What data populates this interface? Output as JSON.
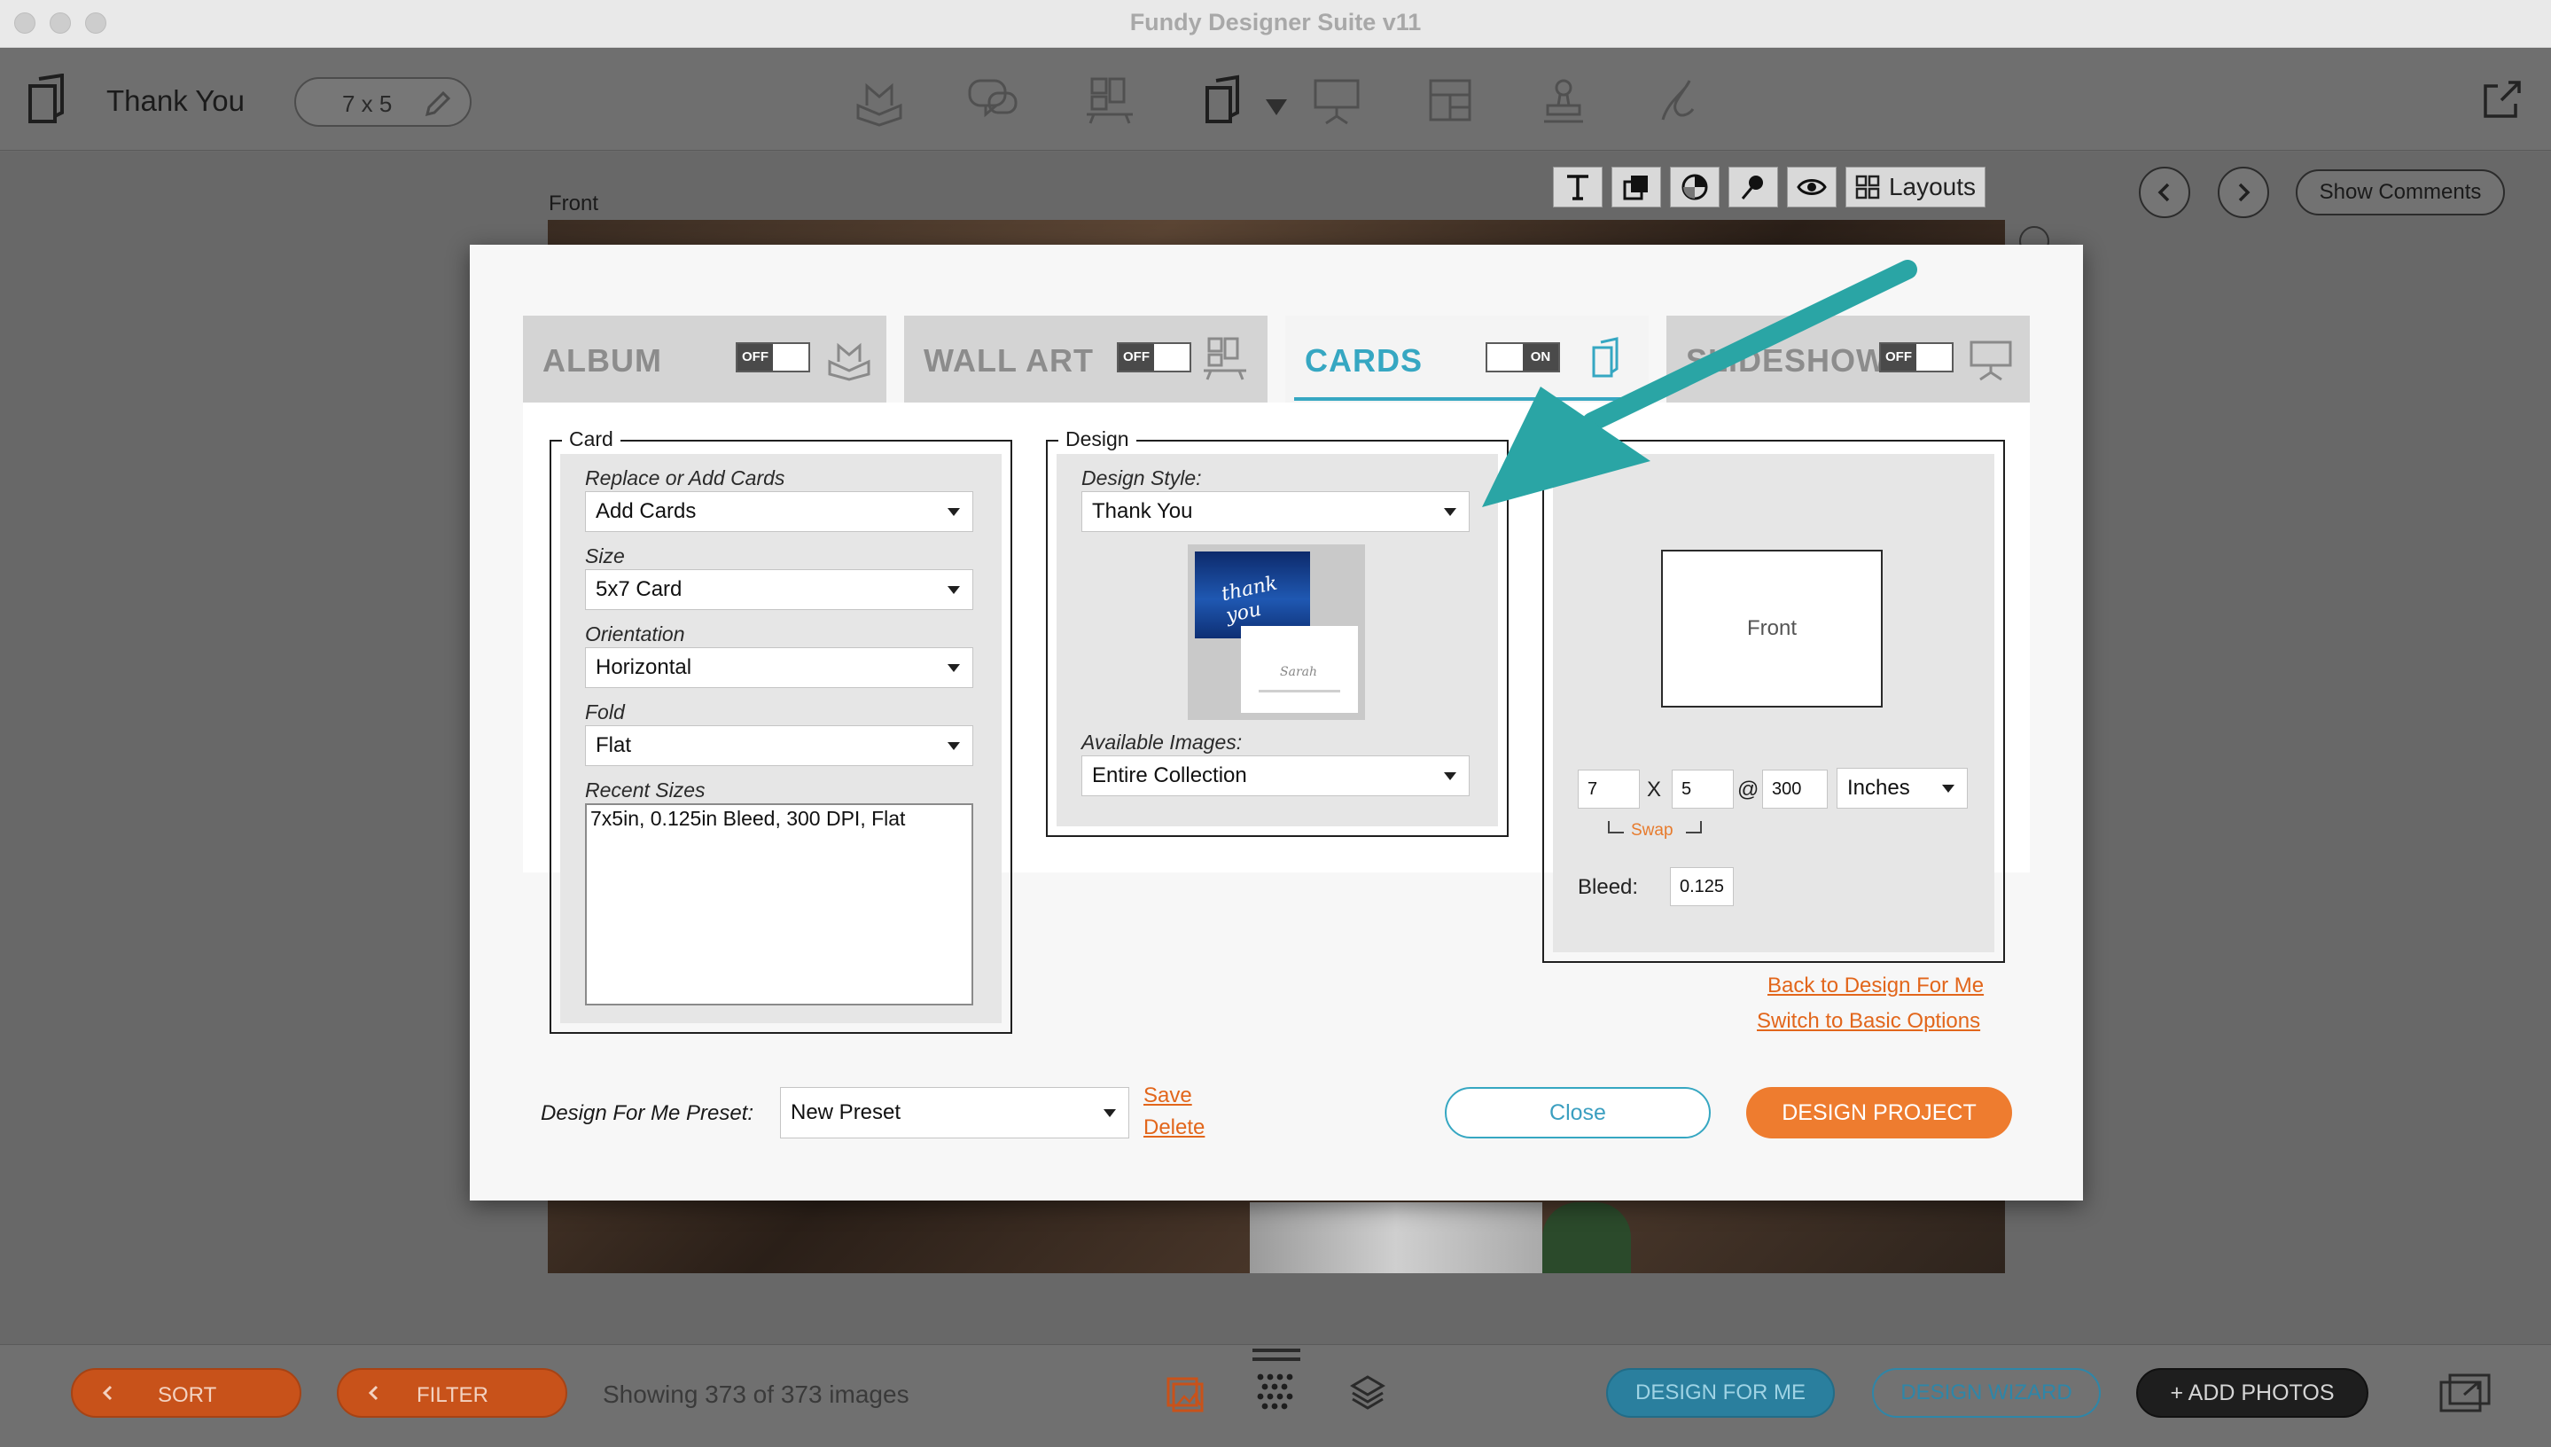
{
  "window": {
    "title": "Fundy Designer Suite v11"
  },
  "toolbar": {
    "doc_title": "Thank You",
    "size_pill": "7 x 5",
    "mode_icons": [
      "album-icon",
      "chat-icon",
      "wall-art-icon",
      "cards-icon",
      "slideshow-icon",
      "layout-icon",
      "stamp-icon",
      "signature-icon"
    ]
  },
  "workspace": {
    "front_label": "Front",
    "layouts_label": "Layouts",
    "show_comments_label": "Show Comments"
  },
  "modal": {
    "tabs": [
      {
        "label": "ALBUM",
        "toggle": "OFF",
        "active": false
      },
      {
        "label": "WALL ART",
        "toggle": "OFF",
        "active": false
      },
      {
        "label": "CARDS",
        "toggle": "ON",
        "active": true
      },
      {
        "label": "SLIDESHOW",
        "toggle": "OFF",
        "active": false
      }
    ],
    "card_group": {
      "legend": "Card",
      "replace_label": "Replace or Add Cards",
      "replace_value": "Add Cards",
      "size_label": "Size",
      "size_value": "5x7 Card",
      "orientation_label": "Orientation",
      "orientation_value": "Horizontal",
      "fold_label": "Fold",
      "fold_value": "Flat",
      "recent_label": "Recent Sizes",
      "recent_items": [
        "7x5in, 0.125in Bleed, 300 DPI, Flat"
      ]
    },
    "design_group": {
      "legend": "Design",
      "style_label": "Design Style:",
      "style_value": "Thank You",
      "thumb_script": "thank you",
      "thumb_signature": "Sarah",
      "images_label": "Available Images:",
      "images_value": "Entire Collection"
    },
    "size_group": {
      "legend": "Size",
      "front_label": "Front",
      "width": "7",
      "x_symbol": "X",
      "height": "5",
      "at_symbol": "@",
      "dpi": "300",
      "units_value": "Inches",
      "swap_label": "Swap",
      "bleed_label": "Bleed:",
      "bleed_value": "0.125"
    },
    "links": {
      "back_to_design": "Back to Design For Me",
      "switch_basic": "Switch to Basic Options"
    },
    "footer": {
      "preset_label": "Design For Me Preset:",
      "preset_value": "New Preset",
      "save_link": "Save",
      "delete_link": "Delete",
      "close_button": "Close",
      "design_button": "DESIGN PROJECT"
    }
  },
  "bottombar": {
    "sort_label": "SORT",
    "filter_label": "FILTER",
    "showing_text": "Showing 373 of 373 images",
    "design_for_me_label": "DESIGN FOR ME",
    "design_wizard_label": "DESIGN WIZARD",
    "add_photos_label": "+ ADD PHOTOS"
  },
  "colors": {
    "accent_teal": "#36a7c2",
    "accent_orange": "#ee7c2f",
    "annotation_arrow": "#2aa5a5"
  }
}
